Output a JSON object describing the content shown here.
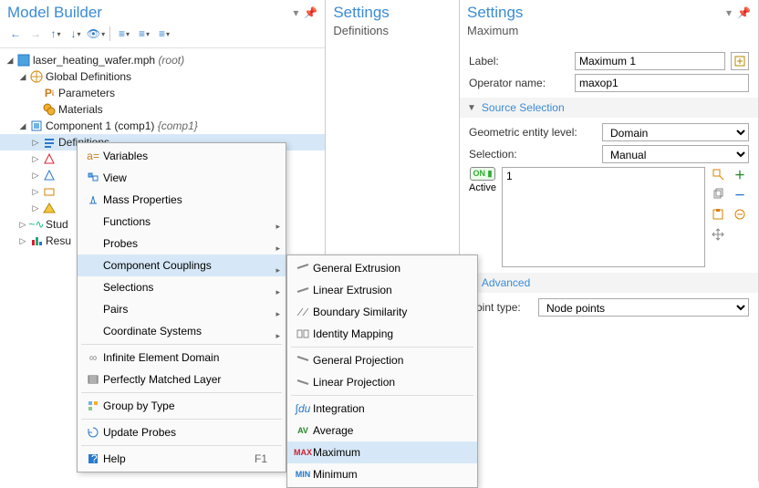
{
  "left": {
    "title": "Model Builder",
    "tree": {
      "root": {
        "label": "laser_heating_wafer.mph",
        "suffix_i": "(root)"
      },
      "global": "Global Definitions",
      "parameters": "Parameters",
      "materials": "Materials",
      "component": "Component 1 (comp1)",
      "component_suffix_i": "{comp1}",
      "definitions": "Definitions",
      "node_a": "",
      "node_b": "",
      "node_c": "",
      "node_d": "",
      "study": "Stud",
      "results": "Resu"
    }
  },
  "mid": {
    "title": "Settings",
    "sub": "Definitions"
  },
  "right": {
    "title": "Settings",
    "sub": "Maximum",
    "label_lbl": "Label:",
    "label_val": "Maximum 1",
    "opname_lbl": "Operator name:",
    "opname_val": "maxop1",
    "sec_source": "Source Selection",
    "gel_lbl": "Geometric entity level:",
    "gel_val": "Domain",
    "sel_lbl": "Selection:",
    "sel_val": "Manual",
    "active": "Active",
    "list_item": "1",
    "sec_adv": "Advanced",
    "pt_lbl": "Point type:",
    "pt_val": "Node points"
  },
  "menu1": {
    "variables": "Variables",
    "view": "View",
    "mass": "Mass Properties",
    "functions": "Functions",
    "probes": "Probes",
    "couplings": "Component Couplings",
    "selections": "Selections",
    "pairs": "Pairs",
    "coords": "Coordinate Systems",
    "ied": "Infinite Element Domain",
    "pml": "Perfectly Matched Layer",
    "group": "Group by Type",
    "update": "Update Probes",
    "help": "Help",
    "help_short": "F1"
  },
  "menu2": {
    "gext": "General Extrusion",
    "lext": "Linear Extrusion",
    "bsim": "Boundary Similarity",
    "imap": "Identity Mapping",
    "gproj": "General Projection",
    "lproj": "Linear Projection",
    "integ": "Integration",
    "avg": "Average",
    "max": "Maximum",
    "min": "Minimum"
  }
}
